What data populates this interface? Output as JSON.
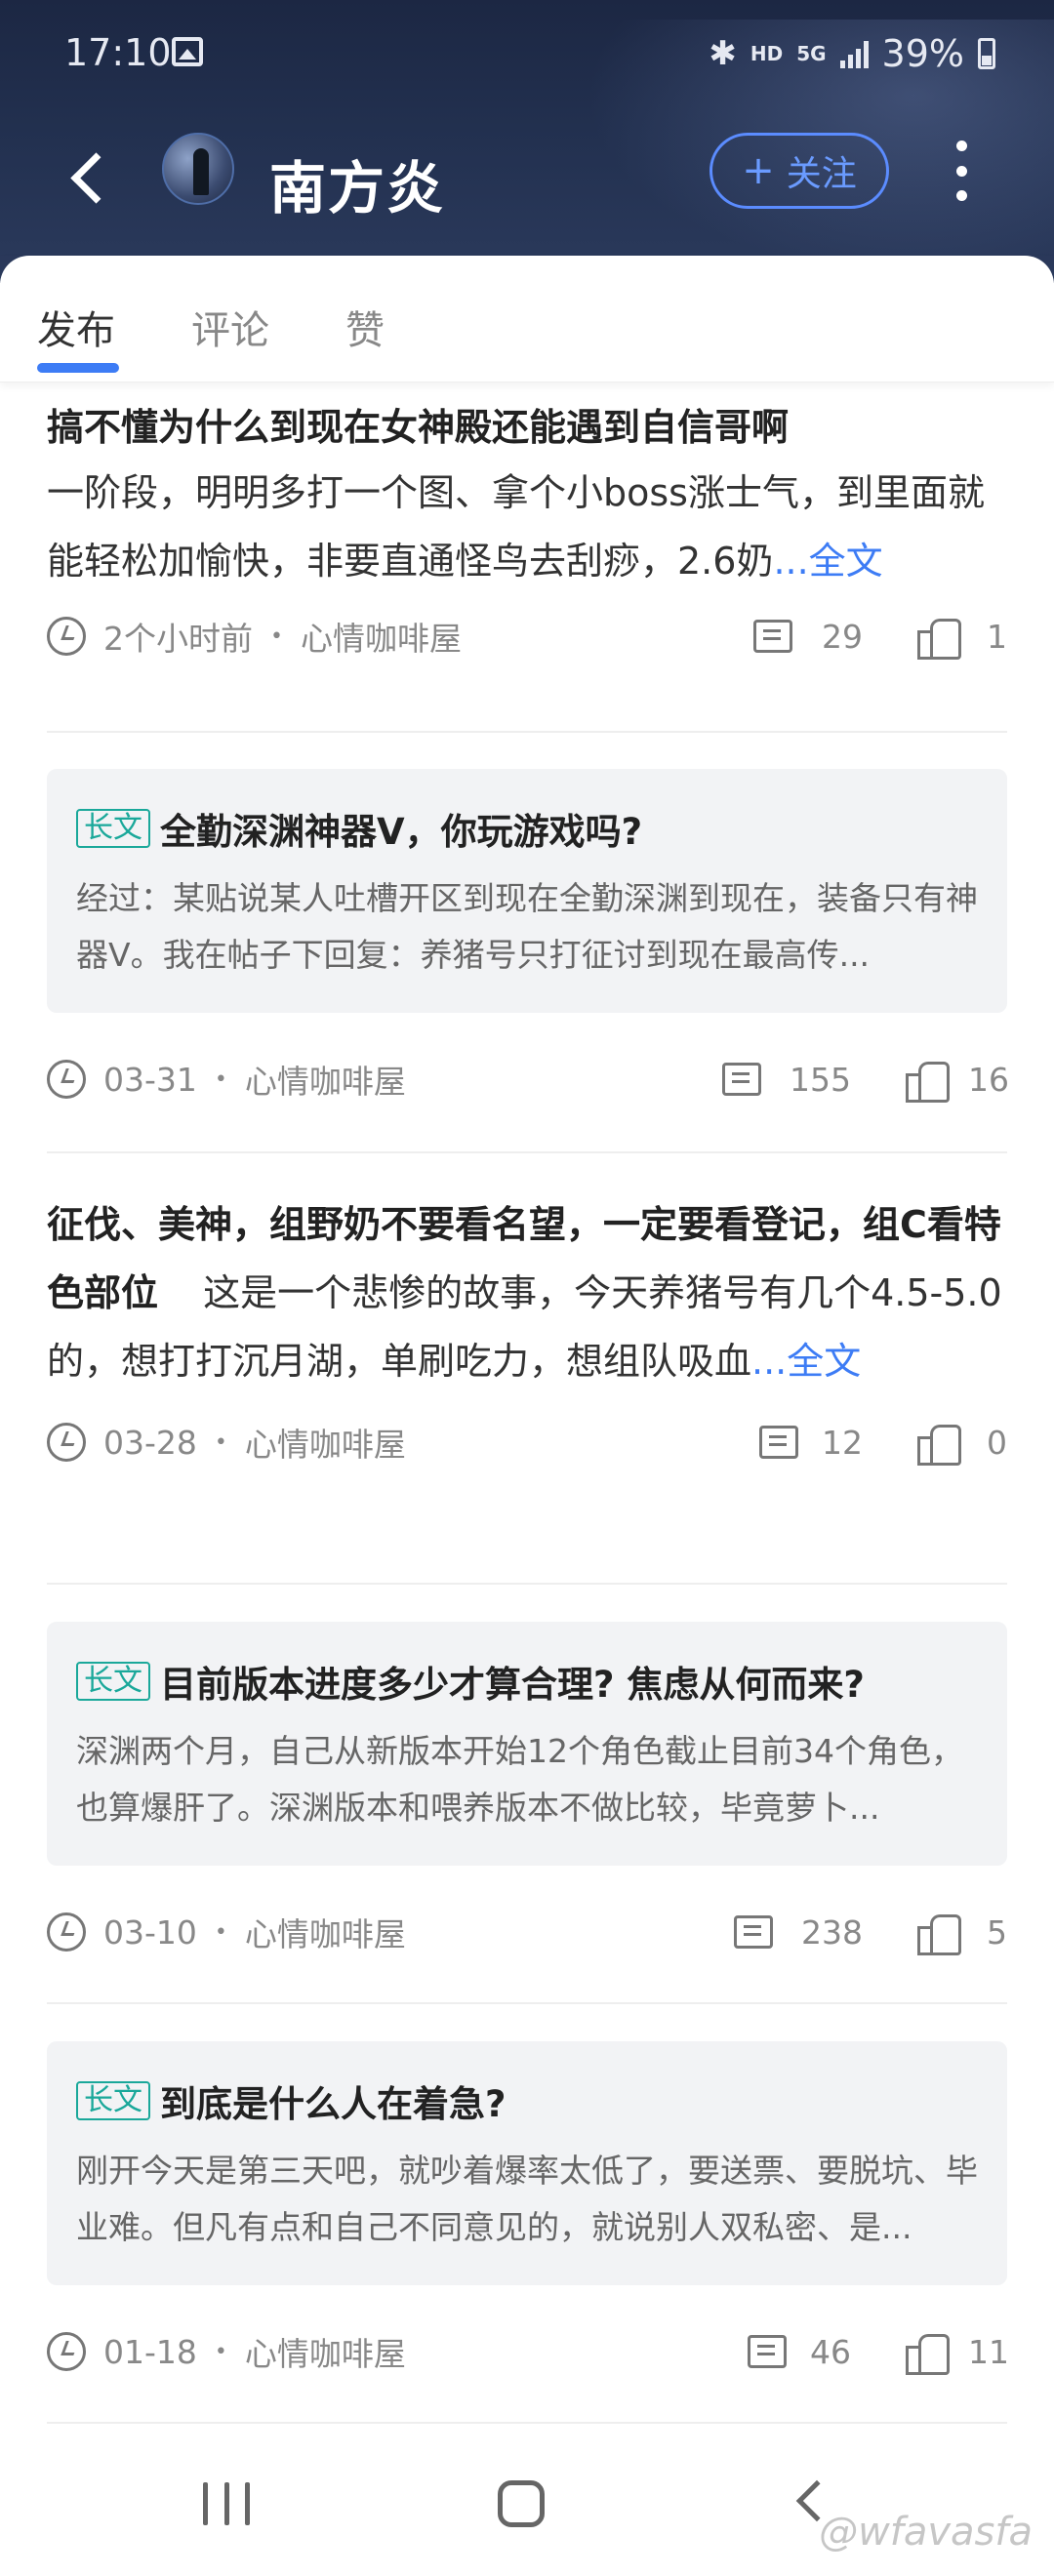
{
  "status_bar": {
    "time": "17:10",
    "hd": "HD",
    "net": "5G",
    "battery": "39%"
  },
  "header": {
    "username": "南方炎",
    "follow_plus": "+",
    "follow_label": "关注"
  },
  "tabs": [
    "发布",
    "评论",
    "赞"
  ],
  "posts": [
    {
      "title": "搞不懂为什么到现在女神殿还能遇到自信哥啊",
      "body": "一阶段，明明多打一个图、拿个小boss涨士气，到里面就能轻松加愉快，非要直通怪鸟去刮痧，2.6奶",
      "more": "...全文",
      "time": "2个小时前",
      "board": "心情咖啡屋",
      "comments": "29",
      "likes": "1"
    },
    {
      "badge": "长文",
      "title": "全勤深渊神器V，你玩游戏吗?",
      "body": "经过：某贴说某人吐槽开区到现在全勤深渊到现在，装备只有神器V。我在帖子下回复：养猪号只打征讨到现在最高传...",
      "time": "03-31",
      "board": "心情咖啡屋",
      "comments": "155",
      "likes": "16"
    },
    {
      "title": "征伐、美神，组野奶不要看名望，一定要看登记，组C看特色部位",
      "body": "这是一个悲惨的故事，今天养猪号有几个4.5-5.0的，想打打沉月湖，单刷吃力，想组队吸血",
      "more": "...全文",
      "time": "03-28",
      "board": "心情咖啡屋",
      "comments": "12",
      "likes": "0"
    },
    {
      "badge": "长文",
      "title": "目前版本进度多少才算合理? 焦虑从何而来?",
      "body": "深渊两个月，自己从新版本开始12个角色截止目前34个角色，也算爆肝了。深渊版本和喂养版本不做比较，毕竟萝卜...",
      "time": "03-10",
      "board": "心情咖啡屋",
      "comments": "238",
      "likes": "5"
    },
    {
      "badge": "长文",
      "title": "到底是什么人在着急?",
      "body": "刚开今天是第三天吧，就吵着爆率太低了，要送票、要脱坑、毕业难。但凡有点和自己不同意见的，就说别人双私密、是...",
      "time": "01-18",
      "board": "心情咖啡屋",
      "comments": "46",
      "likes": "11"
    }
  ],
  "meta_dot": "•",
  "watermark": "@wfavasfa"
}
